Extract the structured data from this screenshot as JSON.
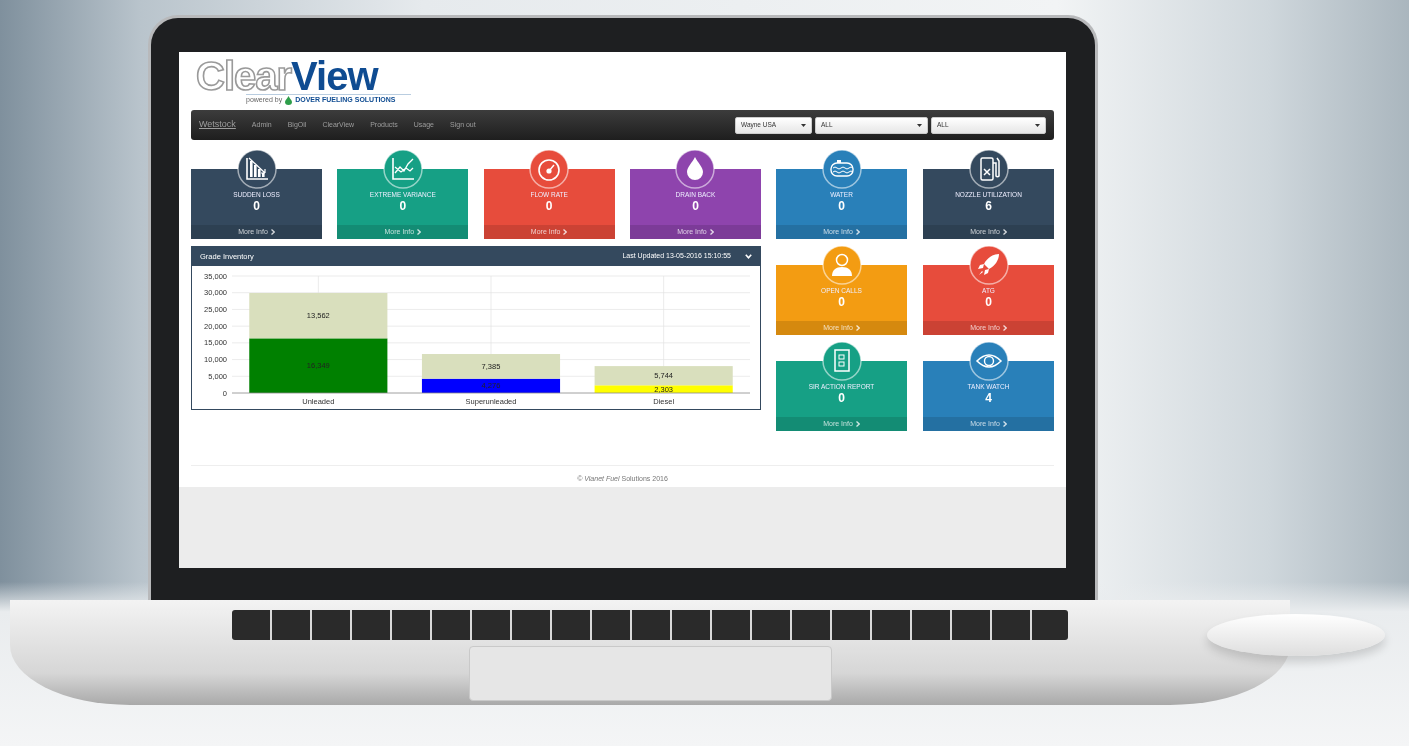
{
  "logo": {
    "word_1": "Clear",
    "word_2": "View",
    "tagline": "powered by",
    "company": "DOVER FUELING SOLUTIONS"
  },
  "navbar": {
    "brand": "Wetstock",
    "links": [
      "Admin",
      "BigOil",
      "ClearView",
      "Products",
      "Usage",
      "Sign out"
    ],
    "selects": [
      {
        "value": "Wayne USA"
      },
      {
        "value": "ALL"
      },
      {
        "value": "ALL"
      }
    ]
  },
  "tiles": [
    {
      "title": "SUDDEN LOSS",
      "value": "0",
      "link": "More Info",
      "color": "#34495e"
    },
    {
      "title": "EXTREME VARIANCE",
      "value": "0",
      "link": "More Info",
      "color": "#16a085"
    },
    {
      "title": "FLOW RATE",
      "value": "0",
      "link": "More Info",
      "color": "#e74c3c"
    },
    {
      "title": "DRAIN BACK",
      "value": "0",
      "link": "More Info",
      "color": "#8e44ad"
    },
    {
      "title": "WATER",
      "value": "0",
      "link": "More Info",
      "color": "#2980b9"
    },
    {
      "title": "NOZZLE UTILIZATION",
      "value": "6",
      "link": "More Info",
      "color": "#34495e"
    },
    {
      "title": "OPEN CALLS",
      "value": "0",
      "link": "More Info",
      "color": "#f39c12"
    },
    {
      "title": "ATG",
      "value": "0",
      "link": "More Info",
      "color": "#e74c3c"
    },
    {
      "title": "SIR ACTION REPORT",
      "value": "0",
      "link": "More Info",
      "color": "#16a085"
    },
    {
      "title": "TANK WATCH",
      "value": "4",
      "link": "More Info",
      "color": "#2980b9"
    }
  ],
  "grade_inventory": {
    "title": "Grade Inventory",
    "updated": "Last Updated 13-05-2016 15:10:55",
    "chart_data": {
      "type": "bar",
      "stacked": true,
      "categories": [
        "Unleaded",
        "Superunleaded",
        "Diesel"
      ],
      "ylim": [
        0,
        35000
      ],
      "yticks": [
        {
          "value": 0,
          "label": "0"
        },
        {
          "value": 5000,
          "label": "5,000"
        },
        {
          "value": 10000,
          "label": "10,000"
        },
        {
          "value": 15000,
          "label": "15,000"
        },
        {
          "value": 20000,
          "label": "20,000"
        },
        {
          "value": 25000,
          "label": "25,000"
        },
        {
          "value": 30000,
          "label": "30,000"
        },
        {
          "value": 35000,
          "label": "35,000"
        }
      ],
      "grid": true,
      "value_labels": [
        [
          "16,349",
          null,
          null
        ],
        [
          null,
          "4,276",
          null
        ],
        [
          null,
          null,
          "2,303"
        ],
        [
          "13,562",
          "7,385",
          "5,744"
        ]
      ],
      "series": [
        {
          "color": "#008000",
          "values": [
            16349,
            null,
            null
          ]
        },
        {
          "color": "#0000ff",
          "values": [
            null,
            4276,
            null
          ]
        },
        {
          "color": "#ffff00",
          "values": [
            null,
            null,
            2303
          ]
        },
        {
          "color": "#d9dfbd",
          "values": [
            13562,
            7385,
            5744
          ]
        }
      ]
    }
  },
  "footer": "*© Vianet Fuel* Solutions 2016"
}
